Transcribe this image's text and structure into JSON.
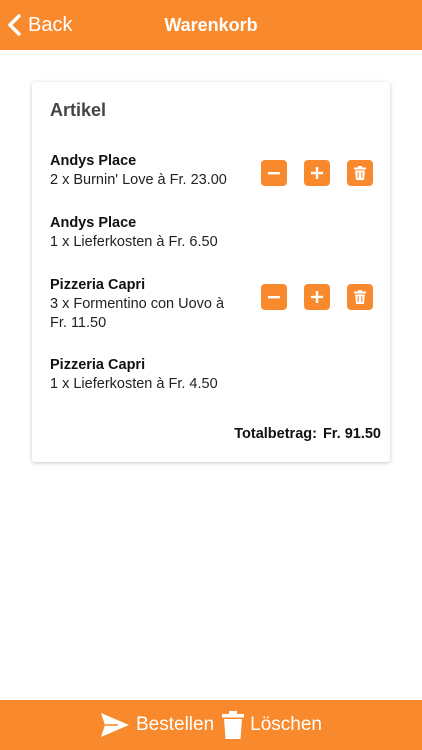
{
  "header": {
    "back_label": "Back",
    "title": "Warenkorb"
  },
  "cart": {
    "title": "Artikel",
    "items": [
      {
        "restaurant": "Andys Place",
        "description": "2 x Burnin' Love à Fr. 23.00",
        "editable": true
      },
      {
        "restaurant": "Andys Place",
        "description": "1 x Lieferkosten à Fr. 6.50",
        "editable": false
      },
      {
        "restaurant": "Pizzeria Capri",
        "description": "3 x Formentino con Uovo à Fr. 11.50",
        "editable": true
      },
      {
        "restaurant": "Pizzeria Capri",
        "description": "1 x Lieferkosten à Fr. 4.50",
        "editable": false
      }
    ],
    "total_label": "Totalbetrag:",
    "total_amount": "Fr. 91.50"
  },
  "footer": {
    "order_label": "Bestellen",
    "delete_label": "Löschen"
  },
  "icons": {
    "back": "chevron-left-icon",
    "minus": "minus-icon",
    "plus": "plus-icon",
    "trash": "trash-icon",
    "send": "send-icon"
  },
  "colors": {
    "accent": "#f88a2d",
    "on_accent": "#ffffff"
  }
}
